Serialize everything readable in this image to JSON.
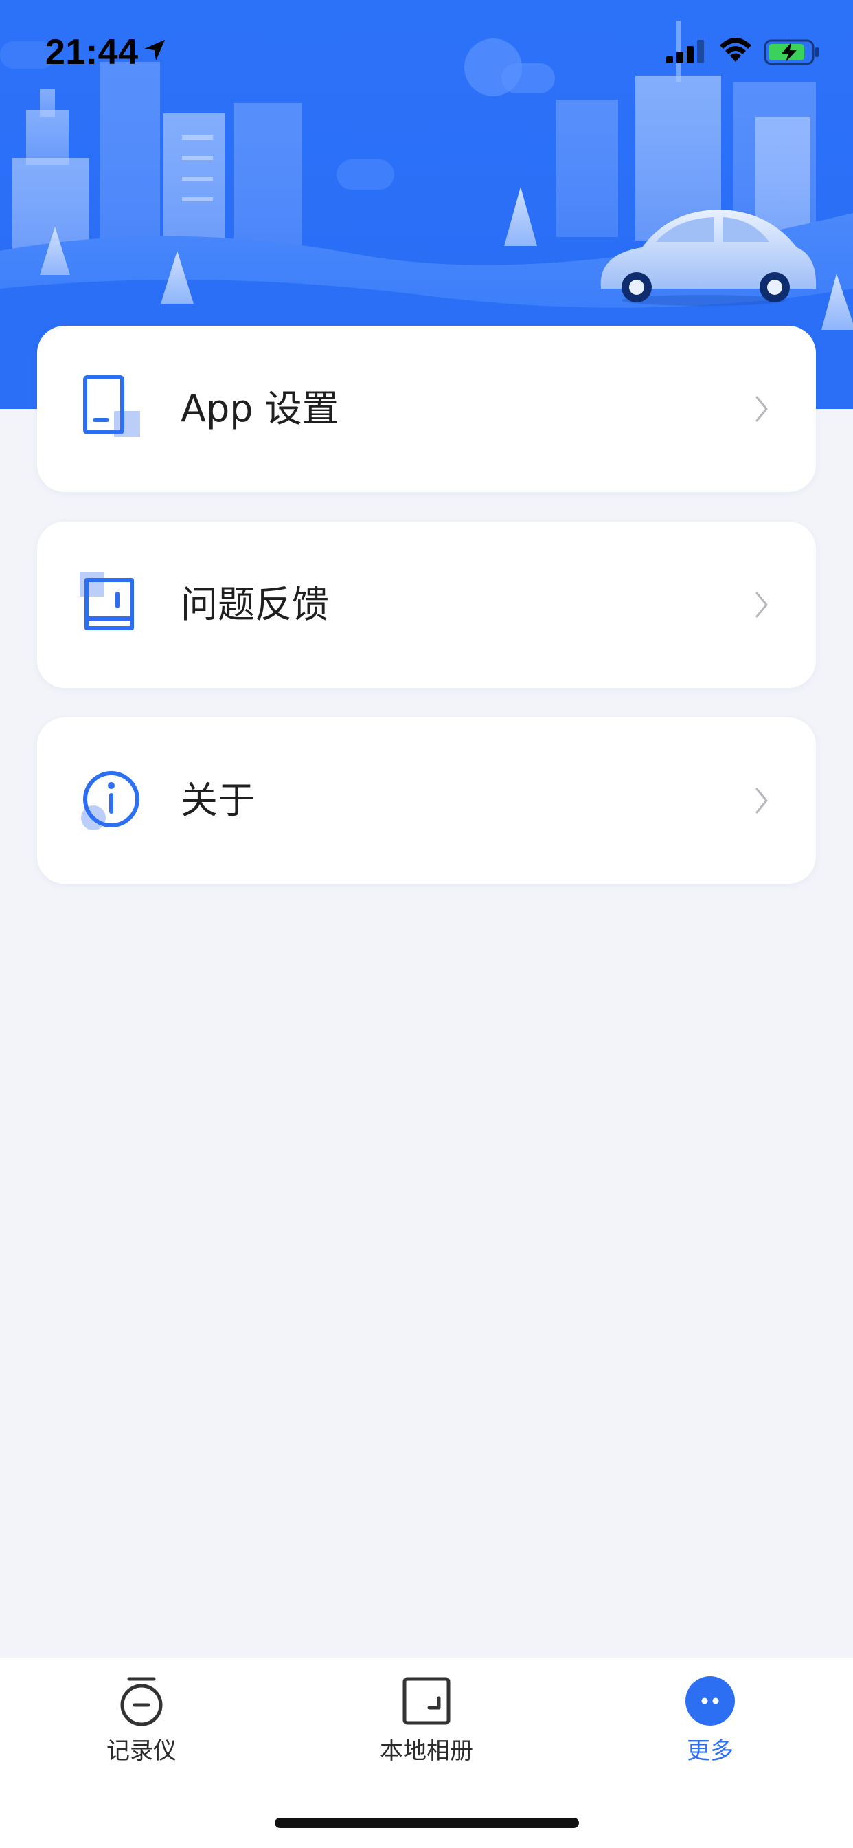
{
  "status_bar": {
    "time": "21:44"
  },
  "colors": {
    "accent": "#2d6ff3",
    "banner_blue": "#2673f8",
    "background": "#f2f4f9"
  },
  "menu": {
    "items": [
      {
        "label": "App 设置",
        "icon": "tablet-icon"
      },
      {
        "label": "问题反馈",
        "icon": "feedback-book-icon"
      },
      {
        "label": "关于",
        "icon": "info-icon"
      }
    ]
  },
  "tabbar": {
    "tabs": [
      {
        "label": "记录仪",
        "icon": "dashcam-icon",
        "active": false
      },
      {
        "label": "本地相册",
        "icon": "album-icon",
        "active": false
      },
      {
        "label": "更多",
        "icon": "more-icon",
        "active": true
      }
    ]
  }
}
